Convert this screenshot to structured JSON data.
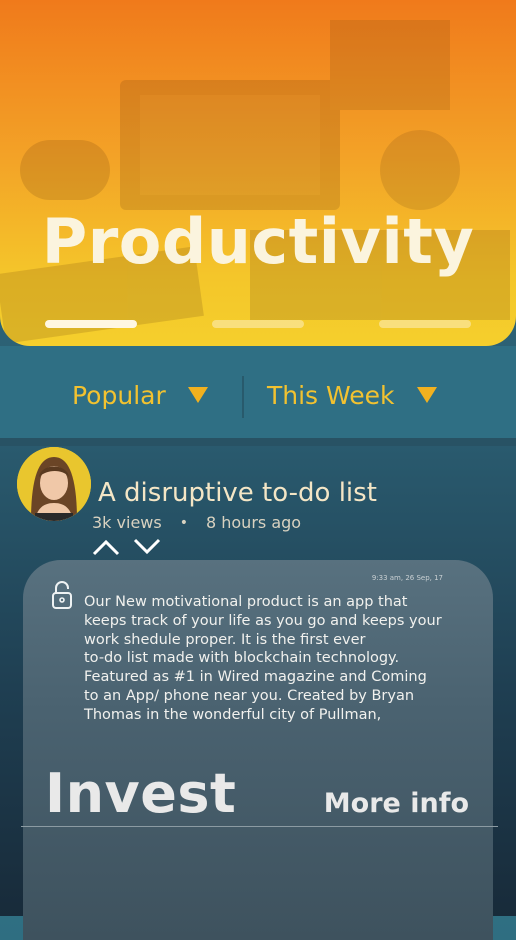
{
  "hero": {
    "title": "Productivity",
    "pager": {
      "count": 3,
      "active": 0
    }
  },
  "filters": {
    "sort_label": "Popular",
    "period_label": "This Week"
  },
  "post": {
    "title": "A disruptive to-do list",
    "views": "3k views",
    "separator": "•",
    "age": "8  hours ago",
    "timestamp": "9:33 am, 26 Sep, 17",
    "body": "Our New motivational product is an app that\nkeeps track of your life as you go and keeps your\nwork shedule proper. It is the first ever\nto-do list made with blockchain technology.\nFeatured as #1 in Wired magazine and Coming\nto an App/ phone near you.  Created by Bryan\nThomas in the wonderful city of Pullman,",
    "invest_label": "Invest",
    "more_info_label": "More info"
  },
  "icons": {
    "upvote": "chevron-up-icon",
    "downvote": "chevron-down-icon",
    "lock": "unlock-icon",
    "filter_arrow": "triangle-down-icon"
  },
  "colors": {
    "accent_yellow": "#f2c230",
    "hero_top": "#f07a1b",
    "hero_bottom": "#f5cf2c",
    "teal": "#2f6f84"
  }
}
